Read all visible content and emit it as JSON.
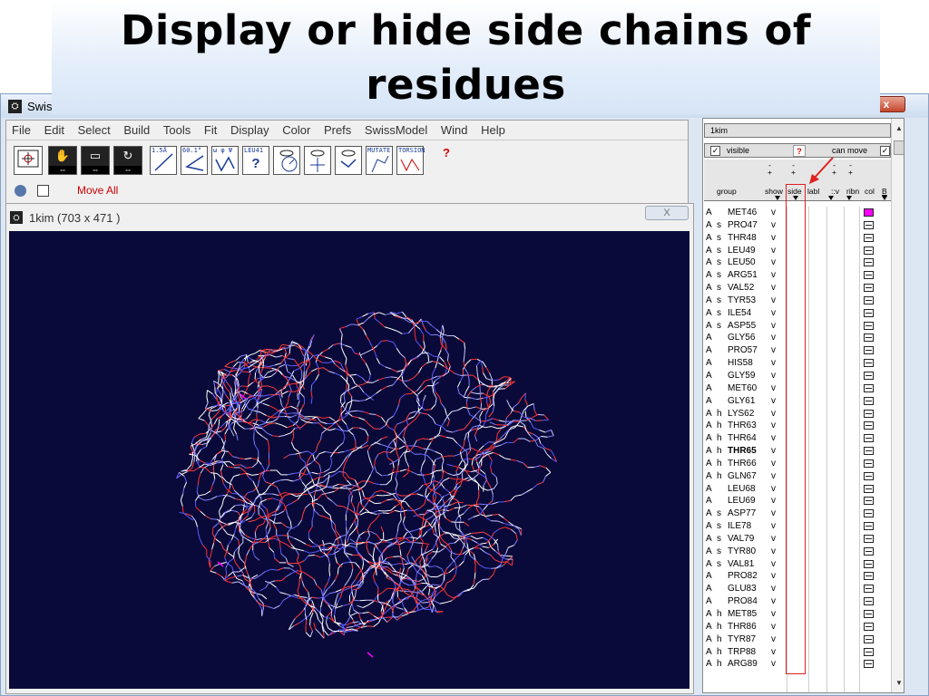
{
  "slide": {
    "title": "Display or hide side chains of residues"
  },
  "main_window": {
    "title": "Swis",
    "close_label": "x"
  },
  "menubar": [
    "File",
    "Edit",
    "Select",
    "Build",
    "Tools",
    "Fit",
    "Display",
    "Color",
    "Prefs",
    "SwissModel",
    "Wind",
    "Help"
  ],
  "toolbar": {
    "move_all_label": "Move All",
    "dist_label": "1.5Å",
    "angle_label": "60.1°",
    "torsion_label": "ω φ Ψ",
    "leu_label": "LEU41",
    "mutate_label": "MUTATE",
    "torsion_tool_label": "TORSION",
    "help_label": "?"
  },
  "graphic_window": {
    "title": "1kim  (703 x 471 )",
    "close_label": "X"
  },
  "control_panel": {
    "name": "1kim",
    "visible_label": "visible",
    "visible_checked": true,
    "can_move_label": "can move",
    "can_move_checked": true,
    "help_label": "?",
    "columns": {
      "group": "group",
      "show": "show",
      "side": "side",
      "labl": "labl",
      "surf": "::v",
      "ribn": "ribn",
      "col": "col",
      "b": "B"
    },
    "plus_minus": "-\n+"
  },
  "residues": [
    {
      "chain": "A",
      "ss": "",
      "name": "MET46",
      "show": "v",
      "color": "magenta"
    },
    {
      "chain": "A",
      "ss": "s",
      "name": "PRO47",
      "show": "v",
      "color": "white"
    },
    {
      "chain": "A",
      "ss": "s",
      "name": "THR48",
      "show": "v",
      "color": "white"
    },
    {
      "chain": "A",
      "ss": "s",
      "name": "LEU49",
      "show": "v",
      "color": "white"
    },
    {
      "chain": "A",
      "ss": "s",
      "name": "LEU50",
      "show": "v",
      "color": "white"
    },
    {
      "chain": "A",
      "ss": "s",
      "name": "ARG51",
      "show": "v",
      "color": "white"
    },
    {
      "chain": "A",
      "ss": "s",
      "name": "VAL52",
      "show": "v",
      "color": "white"
    },
    {
      "chain": "A",
      "ss": "s",
      "name": "TYR53",
      "show": "v",
      "color": "white"
    },
    {
      "chain": "A",
      "ss": "s",
      "name": "ILE54",
      "show": "v",
      "color": "white"
    },
    {
      "chain": "A",
      "ss": "s",
      "name": "ASP55",
      "show": "v",
      "color": "white"
    },
    {
      "chain": "A",
      "ss": "",
      "name": "GLY56",
      "show": "v",
      "color": "white"
    },
    {
      "chain": "A",
      "ss": "",
      "name": "PRO57",
      "show": "v",
      "color": "white"
    },
    {
      "chain": "A",
      "ss": "",
      "name": "HIS58",
      "show": "v",
      "color": "white"
    },
    {
      "chain": "A",
      "ss": "",
      "name": "GLY59",
      "show": "v",
      "color": "white"
    },
    {
      "chain": "A",
      "ss": "",
      "name": "MET60",
      "show": "v",
      "color": "white"
    },
    {
      "chain": "A",
      "ss": "",
      "name": "GLY61",
      "show": "v",
      "color": "white"
    },
    {
      "chain": "A",
      "ss": "h",
      "name": "LYS62",
      "show": "v",
      "color": "white"
    },
    {
      "chain": "A",
      "ss": "h",
      "name": "THR63",
      "show": "v",
      "color": "white"
    },
    {
      "chain": "A",
      "ss": "h",
      "name": "THR64",
      "show": "v",
      "color": "white"
    },
    {
      "chain": "A",
      "ss": "h",
      "name": "THR65",
      "show": "v",
      "color": "white",
      "bold": true
    },
    {
      "chain": "A",
      "ss": "h",
      "name": "THR66",
      "show": "v",
      "color": "white"
    },
    {
      "chain": "A",
      "ss": "h",
      "name": "GLN67",
      "show": "v",
      "color": "white"
    },
    {
      "chain": "A",
      "ss": "",
      "name": "LEU68",
      "show": "v",
      "color": "white"
    },
    {
      "chain": "A",
      "ss": "",
      "name": "LEU69",
      "show": "v",
      "color": "white"
    },
    {
      "chain": "A",
      "ss": "s",
      "name": "ASP77",
      "show": "v",
      "color": "white"
    },
    {
      "chain": "A",
      "ss": "s",
      "name": "ILE78",
      "show": "v",
      "color": "white"
    },
    {
      "chain": "A",
      "ss": "s",
      "name": "VAL79",
      "show": "v",
      "color": "white"
    },
    {
      "chain": "A",
      "ss": "s",
      "name": "TYR80",
      "show": "v",
      "color": "white"
    },
    {
      "chain": "A",
      "ss": "s",
      "name": "VAL81",
      "show": "v",
      "color": "white"
    },
    {
      "chain": "A",
      "ss": "",
      "name": "PRO82",
      "show": "v",
      "color": "white"
    },
    {
      "chain": "A",
      "ss": "",
      "name": "GLU83",
      "show": "v",
      "color": "white"
    },
    {
      "chain": "A",
      "ss": "",
      "name": "PRO84",
      "show": "v",
      "color": "white"
    },
    {
      "chain": "A",
      "ss": "h",
      "name": "MET85",
      "show": "v",
      "color": "white"
    },
    {
      "chain": "A",
      "ss": "h",
      "name": "THR86",
      "show": "v",
      "color": "white"
    },
    {
      "chain": "A",
      "ss": "h",
      "name": "TYR87",
      "show": "v",
      "color": "white"
    },
    {
      "chain": "A",
      "ss": "h",
      "name": "TRP88",
      "show": "v",
      "color": "white"
    },
    {
      "chain": "A",
      "ss": "h",
      "name": "ARG89",
      "show": "v",
      "color": "white"
    }
  ],
  "colors": {
    "canvas_bg": "#0a0a3a",
    "annotation_red": "#e02020",
    "move_all_red": "#d00000",
    "residue_magenta": "#ff00ff"
  }
}
